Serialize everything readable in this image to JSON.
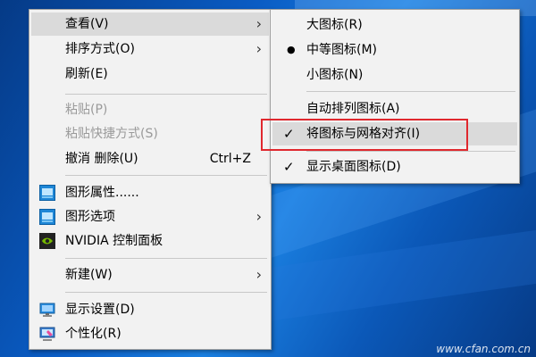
{
  "main_menu": {
    "items": [
      {
        "label": "查看(V)",
        "has_submenu": true,
        "highlighted": true
      },
      {
        "label": "排序方式(O)",
        "has_submenu": true
      },
      {
        "label": "刷新(E)"
      },
      {
        "label": "粘贴(P)",
        "disabled": true
      },
      {
        "label": "粘贴快捷方式(S)",
        "disabled": true
      },
      {
        "label": "撤消 删除(U)",
        "shortcut": "Ctrl+Z"
      },
      {
        "label": "图形属性......",
        "icon": "intel-graphics-icon"
      },
      {
        "label": "图形选项",
        "icon": "intel-graphics-icon",
        "has_submenu": true
      },
      {
        "label": "NVIDIA 控制面板",
        "icon": "nvidia-icon"
      },
      {
        "label": "新建(W)",
        "has_submenu": true
      },
      {
        "label": "显示设置(D)",
        "icon": "display-settings-icon"
      },
      {
        "label": "个性化(R)",
        "icon": "personalize-icon"
      }
    ]
  },
  "view_submenu": {
    "items": [
      {
        "label": "大图标(R)"
      },
      {
        "label": "中等图标(M)",
        "mark": "bullet"
      },
      {
        "label": "小图标(N)"
      },
      {
        "label": "自动排列图标(A)"
      },
      {
        "label": "将图标与网格对齐(I)",
        "mark": "check",
        "highlighted": true
      },
      {
        "label": "显示桌面图标(D)",
        "mark": "check"
      }
    ],
    "check_glyph": "✓",
    "bullet_glyph": "●"
  },
  "submenu_arrow": "›",
  "watermark": "www.cfan.com.cn",
  "colors": {
    "accent_box": "#e0282e",
    "menu_bg": "#f2f2f2",
    "highlight": "#dadada"
  }
}
